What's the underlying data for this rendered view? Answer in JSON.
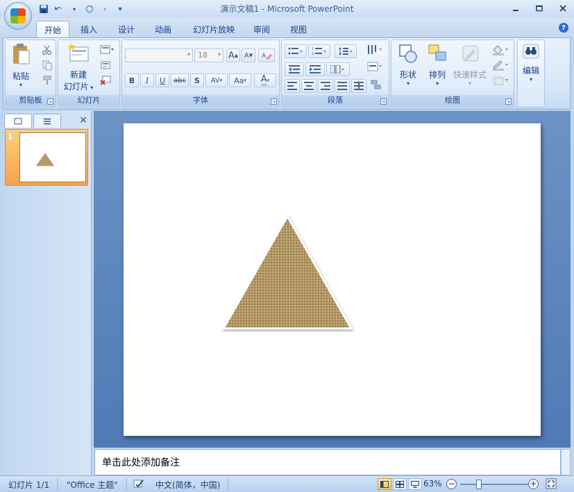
{
  "window": {
    "title": "演示文稿1 - Microsoft PowerPoint"
  },
  "quick_access": {
    "save": "save-icon",
    "undo": "undo-icon",
    "redo": "redo-icon",
    "customize": "▾"
  },
  "tabs": [
    "开始",
    "插入",
    "设计",
    "动画",
    "幻灯片放映",
    "审阅",
    "视图"
  ],
  "active_tab": "开始",
  "ribbon": {
    "clipboard": {
      "label": "剪贴板",
      "paste": "粘贴"
    },
    "slides": {
      "label": "幻灯片",
      "new_slide_line1": "新建",
      "new_slide_line2": "幻灯片"
    },
    "font": {
      "label": "字体",
      "font_name": "",
      "font_size": "18",
      "bold": "B",
      "italic": "I",
      "underline": "U",
      "strike": "abc",
      "shadow": "S",
      "spacing": "AV",
      "case": "Aa",
      "color": "A",
      "grow": "A",
      "shrink": "A"
    },
    "paragraph": {
      "label": "段落"
    },
    "drawing": {
      "label": "绘图",
      "shapes": "形状",
      "arrange": "排列",
      "quick_styles": "快速样式"
    },
    "editing": {
      "label": "编辑"
    }
  },
  "slide_panel": {
    "thumb_number": "1"
  },
  "notes": {
    "placeholder": "单击此处添加备注"
  },
  "status": {
    "slide_info": "幻灯片 1/1",
    "theme": "\"Office 主题\"",
    "language": "中文(简体，中国)",
    "zoom": "63%",
    "zoom_fraction": 0.63
  },
  "colors": {
    "accent": "#15428b",
    "ribbon_bg": "#dbe8f8",
    "workspace": "#5f87bd",
    "active_thumb": "#f6aa52",
    "triangle": "#b59a6a"
  }
}
